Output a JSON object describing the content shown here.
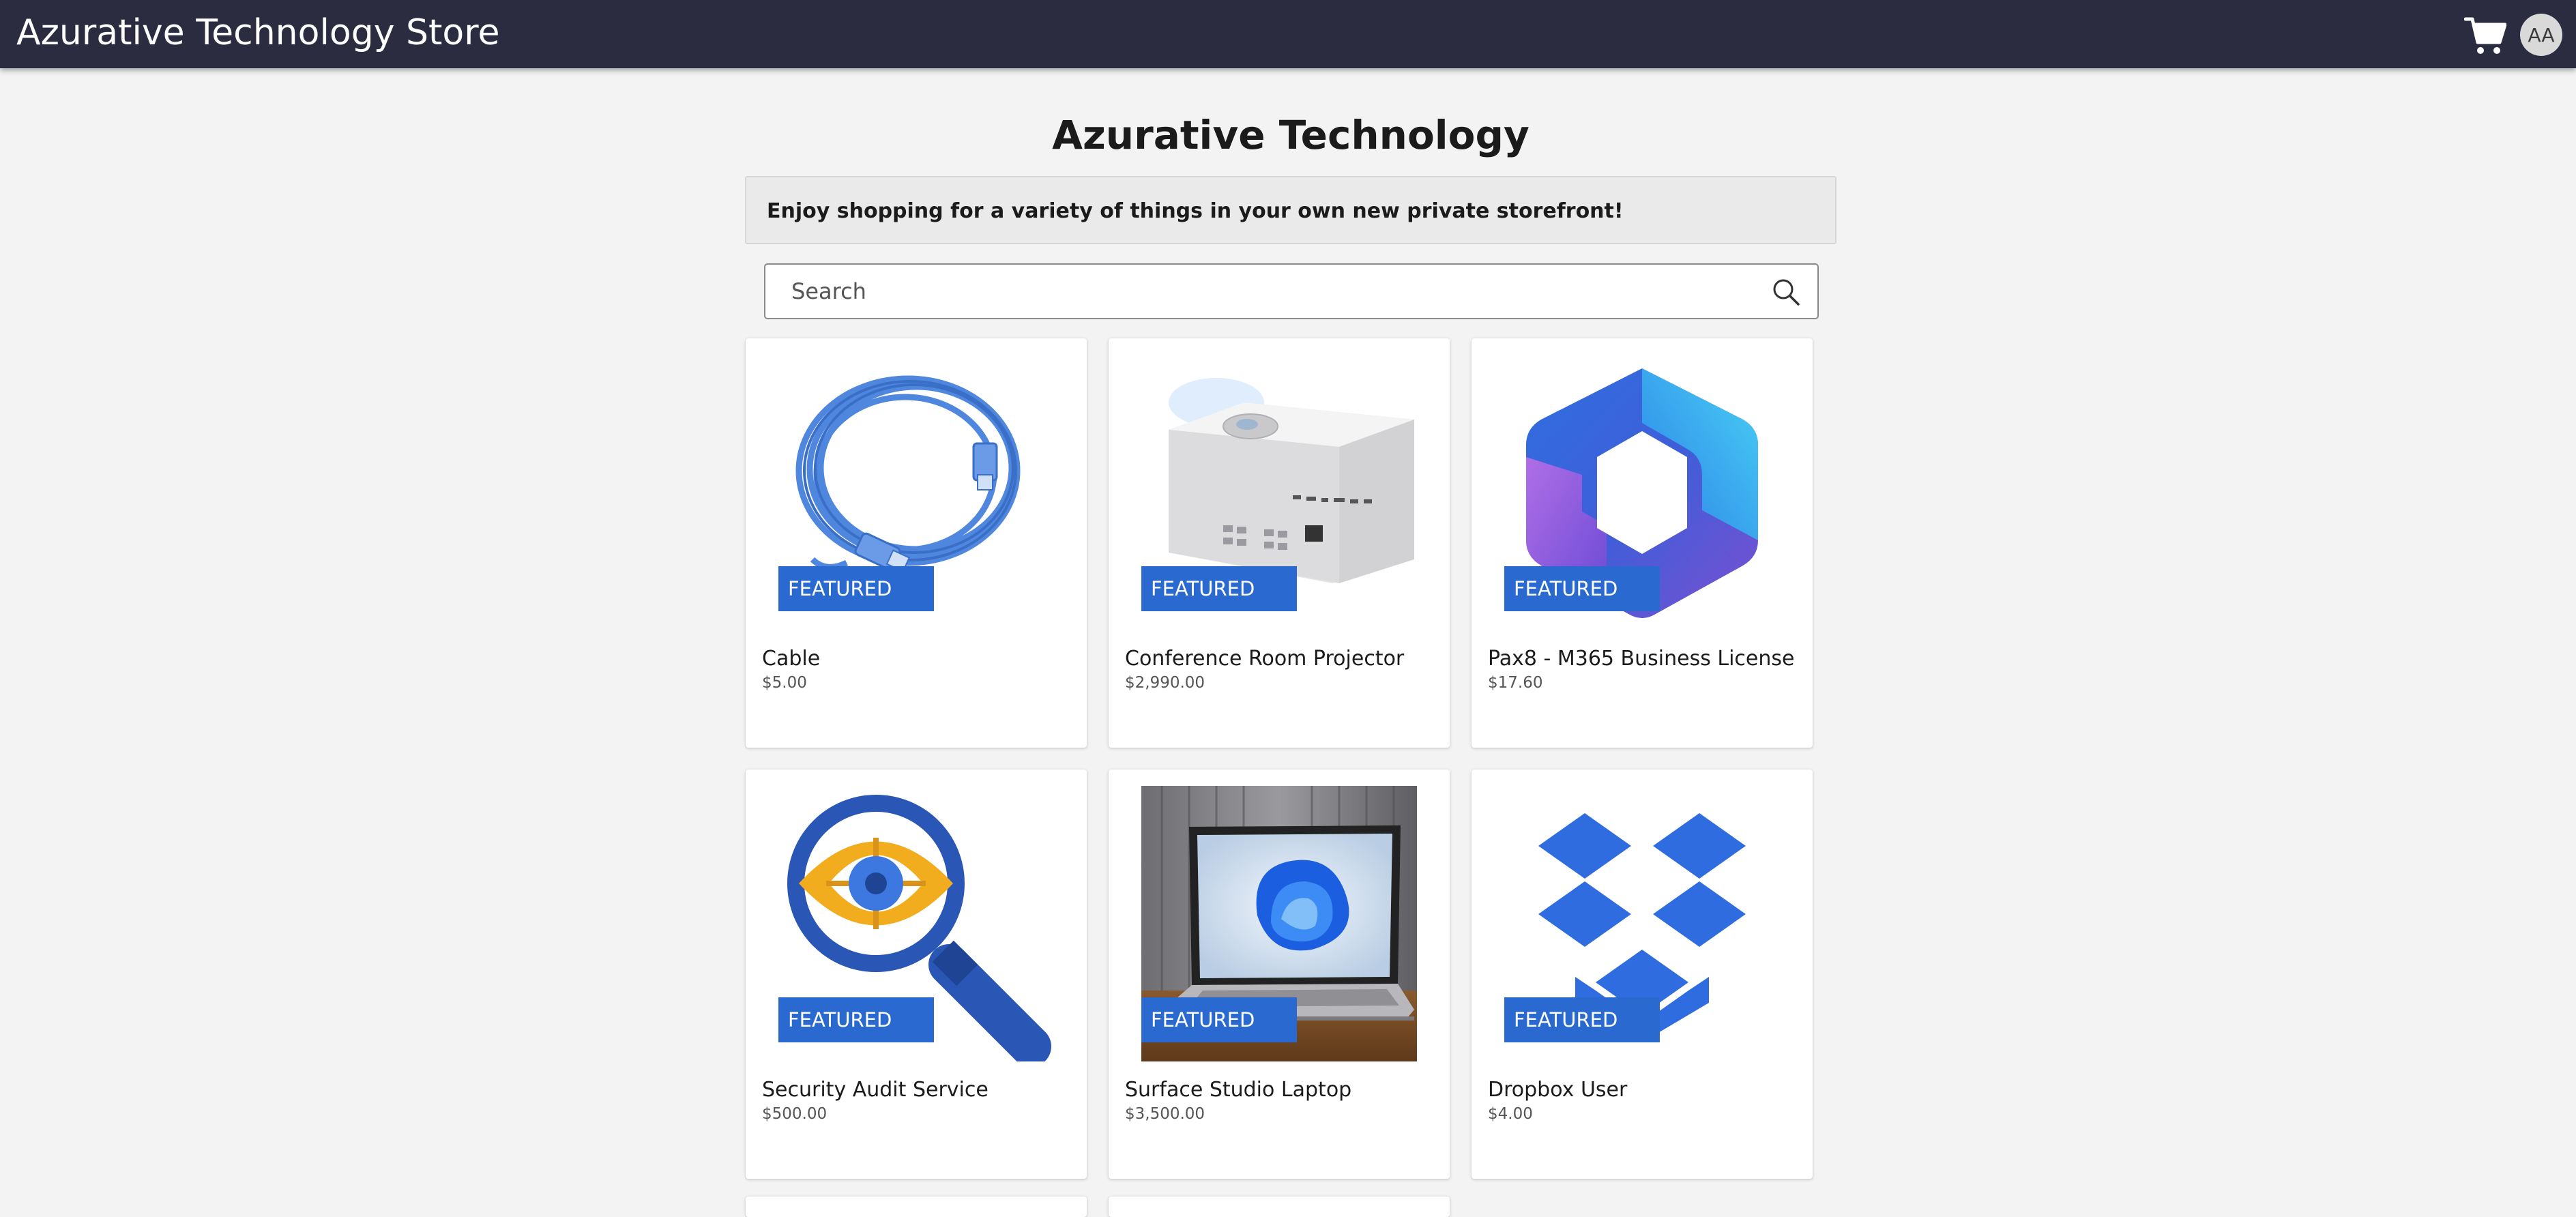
{
  "header": {
    "app_title": "Azurative Technology Store",
    "avatar_initials": "AA",
    "bar_color": "#2b2c40"
  },
  "main": {
    "title": "Azurative Technology",
    "banner_text": "Enjoy shopping for a variety of things in your own new private storefront!",
    "search": {
      "placeholder": "Search",
      "value": ""
    }
  },
  "badge_color": "#2a6ad0",
  "products": [
    {
      "name": "Cable",
      "price": "$5.00",
      "badge": "FEATURED",
      "image_icon": "network-cable-image"
    },
    {
      "name": "Conference Room Projector",
      "price": "$2,990.00",
      "badge": "FEATURED",
      "image_icon": "projector-image"
    },
    {
      "name": "Pax8 - M365 Business License",
      "price": "$17.60",
      "badge": "FEATURED",
      "image_icon": "m365-logo-image"
    },
    {
      "name": "Security Audit Service",
      "price": "$500.00",
      "badge": "FEATURED",
      "image_icon": "magnifier-eye-image"
    },
    {
      "name": "Surface Studio Laptop",
      "price": "$3,500.00",
      "badge": "FEATURED",
      "image_icon": "laptop-photo-image"
    },
    {
      "name": "Dropbox User",
      "price": "$4.00",
      "badge": "FEATURED",
      "image_icon": "dropbox-logo-image"
    }
  ]
}
